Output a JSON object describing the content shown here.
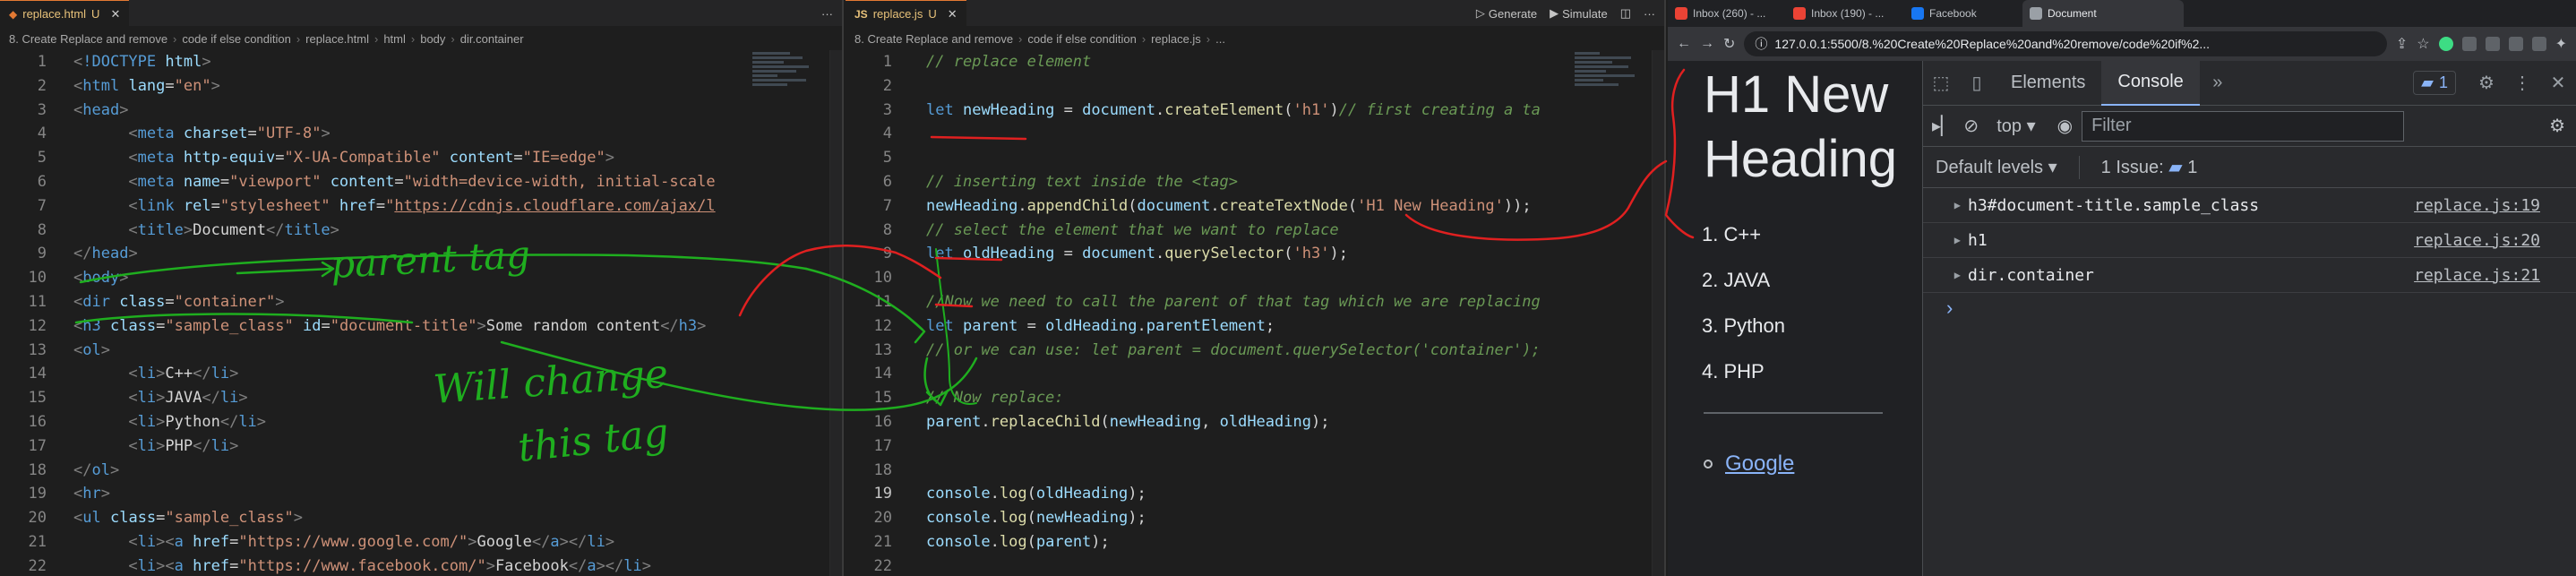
{
  "html_editor": {
    "tab": {
      "filename": "replace.html",
      "status": "U"
    },
    "breadcrumb": [
      "8. Create Replace and remove",
      "code if else condition",
      "replace.html",
      "html",
      "body",
      "dir.container"
    ],
    "lines": [
      {
        "n": "1",
        "html": "<span class='br'>&lt;</span><span class='tag'>!DOCTYPE</span> <span class='attr'>html</span><span class='br'>&gt;</span>"
      },
      {
        "n": "2",
        "html": "<span class='br'>&lt;</span><span class='tag'>html</span> <span class='attr'>lang</span><span class='punc'>=</span><span class='str'>\"en\"</span><span class='br'>&gt;</span>"
      },
      {
        "n": "3",
        "html": "<span class='br'>&lt;</span><span class='tag'>head</span><span class='br'>&gt;</span>"
      },
      {
        "n": "4",
        "html": "      <span class='br'>&lt;</span><span class='tag'>meta</span> <span class='attr'>charset</span><span class='punc'>=</span><span class='str'>\"UTF-8\"</span><span class='br'>&gt;</span>"
      },
      {
        "n": "5",
        "html": "      <span class='br'>&lt;</span><span class='tag'>meta</span> <span class='attr'>http-equiv</span><span class='punc'>=</span><span class='str'>\"X-UA-Compatible\"</span> <span class='attr'>content</span><span class='punc'>=</span><span class='str'>\"IE=edge\"</span><span class='br'>&gt;</span>"
      },
      {
        "n": "6",
        "html": "      <span class='br'>&lt;</span><span class='tag'>meta</span> <span class='attr'>name</span><span class='punc'>=</span><span class='str'>\"viewport\"</span> <span class='attr'>content</span><span class='punc'>=</span><span class='str'>\"width=device-width, initial-scale</span>"
      },
      {
        "n": "7",
        "html": "      <span class='br'>&lt;</span><span class='tag'>link</span> <span class='attr'>rel</span><span class='punc'>=</span><span class='str'>\"stylesheet\"</span> <span class='attr'>href</span><span class='punc'>=</span><span class='str'>\"</span><span class='link'>https://cdnjs.cloudflare.com/ajax/l</span>"
      },
      {
        "n": "8",
        "html": "      <span class='br'>&lt;</span><span class='tag'>title</span><span class='br'>&gt;</span><span class='txt'>Document</span><span class='br'>&lt;/</span><span class='tag'>title</span><span class='br'>&gt;</span>"
      },
      {
        "n": "9",
        "html": "<span class='br'>&lt;/</span><span class='tag'>head</span><span class='br'>&gt;</span>"
      },
      {
        "n": "10",
        "html": "<span class='br'>&lt;</span><span class='tag'>body</span><span class='br'>&gt;</span>"
      },
      {
        "n": "11",
        "html": "<span class='br'>&lt;</span><span class='tag'>dir</span> <span class='attr'>class</span><span class='punc'>=</span><span class='str'>\"container\"</span><span class='br'>&gt;</span>"
      },
      {
        "n": "12",
        "html": "<span class='br'>&lt;</span><span class='tag'>h3</span> <span class='attr'>class</span><span class='punc'>=</span><span class='str'>\"sample_class\"</span> <span class='attr'>id</span><span class='punc'>=</span><span class='str'>\"document-title\"</span><span class='br'>&gt;</span><span class='txt'>Some random content</span><span class='br'>&lt;/</span><span class='tag'>h3</span><span class='br'>&gt;</span>"
      },
      {
        "n": "13",
        "html": "<span class='br'>&lt;</span><span class='tag'>ol</span><span class='br'>&gt;</span>"
      },
      {
        "n": "14",
        "html": "      <span class='br'>&lt;</span><span class='tag'>li</span><span class='br'>&gt;</span><span class='txt'>C++</span><span class='br'>&lt;/</span><span class='tag'>li</span><span class='br'>&gt;</span>"
      },
      {
        "n": "15",
        "html": "      <span class='br'>&lt;</span><span class='tag'>li</span><span class='br'>&gt;</span><span class='txt'>JAVA</span><span class='br'>&lt;/</span><span class='tag'>li</span><span class='br'>&gt;</span>"
      },
      {
        "n": "16",
        "html": "      <span class='br'>&lt;</span><span class='tag'>li</span><span class='br'>&gt;</span><span class='txt'>Python</span><span class='br'>&lt;/</span><span class='tag'>li</span><span class='br'>&gt;</span>"
      },
      {
        "n": "17",
        "html": "      <span class='br'>&lt;</span><span class='tag'>li</span><span class='br'>&gt;</span><span class='txt'>PHP</span><span class='br'>&lt;/</span><span class='tag'>li</span><span class='br'>&gt;</span>"
      },
      {
        "n": "18",
        "html": "<span class='br'>&lt;/</span><span class='tag'>ol</span><span class='br'>&gt;</span>"
      },
      {
        "n": "19",
        "html": "<span class='br'>&lt;</span><span class='tag'>hr</span><span class='br'>&gt;</span>"
      },
      {
        "n": "20",
        "html": "<span class='br'>&lt;</span><span class='tag'>ul</span> <span class='attr'>class</span><span class='punc'>=</span><span class='str'>\"sample_class\"</span><span class='br'>&gt;</span>"
      },
      {
        "n": "21",
        "html": "      <span class='br'>&lt;</span><span class='tag'>li</span><span class='br'>&gt;&lt;</span><span class='tag'>a</span> <span class='attr'>href</span><span class='punc'>=</span><span class='str'>\"https://www.google.com/\"</span><span class='br'>&gt;</span><span class='txt'>Google</span><span class='br'>&lt;/</span><span class='tag'>a</span><span class='br'>&gt;&lt;/</span><span class='tag'>li</span><span class='br'>&gt;</span>"
      },
      {
        "n": "22",
        "html": "      <span class='br'>&lt;</span><span class='tag'>li</span><span class='br'>&gt;&lt;</span><span class='tag'>a</span> <span class='attr'>href</span><span class='punc'>=</span><span class='str'>\"https://www.facebook.com/\"</span><span class='br'>&gt;</span><span class='txt'>Facebook</span><span class='br'>&lt;/</span><span class='tag'>a</span><span class='br'>&gt;&lt;/</span><span class='tag'>li</span><span class='br'>&gt;</span>"
      }
    ]
  },
  "js_editor": {
    "tab": {
      "filename": "replace.js",
      "status": "U"
    },
    "breadcrumb": [
      "8. Create Replace and remove",
      "code if else condition",
      "replace.js",
      "..."
    ],
    "toolbar": {
      "generate": "Generate",
      "simulate": "Simulate"
    },
    "active_line": "19",
    "lines": [
      {
        "n": "1",
        "html": "<span class='cm'>// replace element</span>"
      },
      {
        "n": "2",
        "html": ""
      },
      {
        "n": "3",
        "html": "<span class='kw'>let</span> <span class='var'>newHeading</span> <span class='punc'>=</span> <span class='var'>document</span><span class='punc'>.</span><span class='fn'>createElement</span><span class='punc'>(</span><span class='str'>'h1'</span><span class='punc'>)</span><span class='cm'>// first creating a ta</span>"
      },
      {
        "n": "4",
        "html": ""
      },
      {
        "n": "5",
        "html": ""
      },
      {
        "n": "6",
        "html": "<span class='cm'>// inserting text inside the &lt;tag&gt;</span>"
      },
      {
        "n": "7",
        "html": "<span class='var'>newHeading</span><span class='punc'>.</span><span class='fn'>appendChild</span><span class='punc'>(</span><span class='var'>document</span><span class='punc'>.</span><span class='fn'>createTextNode</span><span class='punc'>(</span><span class='str'>'H1 New Heading'</span><span class='punc'>));</span>"
      },
      {
        "n": "8",
        "html": "<span class='cm'>// select the element that we want to replace</span>"
      },
      {
        "n": "9",
        "html": "<span class='kw'>let</span> <span class='var'>oldHeading</span> <span class='punc'>=</span> <span class='var'>document</span><span class='punc'>.</span><span class='fn'>querySelector</span><span class='punc'>(</span><span class='str'>'h3'</span><span class='punc'>);</span>"
      },
      {
        "n": "10",
        "html": ""
      },
      {
        "n": "11",
        "html": "<span class='cm'>//Now we need to call the parent of that tag which we are replacing</span>"
      },
      {
        "n": "12",
        "html": "<span class='kw'>let</span> <span class='var'>parent</span> <span class='punc'>=</span> <span class='var'>oldHeading</span><span class='punc'>.</span><span class='var'>parentElement</span><span class='punc'>;</span>"
      },
      {
        "n": "13",
        "html": "<span class='cm'>// or we can use: let parent = document.querySelector('container');</span>"
      },
      {
        "n": "14",
        "html": ""
      },
      {
        "n": "15",
        "html": "<span class='cm'>// Now replace:</span>"
      },
      {
        "n": "16",
        "html": "<span class='var'>parent</span><span class='punc'>.</span><span class='fn'>replaceChild</span><span class='punc'>(</span><span class='var'>newHeading</span><span class='punc'>,</span> <span class='var'>oldHeading</span><span class='punc'>);</span>"
      },
      {
        "n": "17",
        "html": ""
      },
      {
        "n": "18",
        "html": ""
      },
      {
        "n": "19",
        "html": "<span class='var'>console</span><span class='punc'>.</span><span class='fn'>log</span><span class='punc'>(</span><span class='var'>oldHeading</span><span class='punc'>);</span>"
      },
      {
        "n": "20",
        "html": "<span class='var'>console</span><span class='punc'>.</span><span class='fn'>log</span><span class='punc'>(</span><span class='var'>newHeading</span><span class='punc'>);</span>"
      },
      {
        "n": "21",
        "html": "<span class='var'>console</span><span class='punc'>.</span><span class='fn'>log</span><span class='punc'>(</span><span class='var'>parent</span><span class='punc'>);</span>"
      },
      {
        "n": "22",
        "html": ""
      }
    ]
  },
  "annotations": {
    "note1": "parent tag",
    "note2a": "Will change",
    "note2b": "this tag",
    "ink_color": "#1fae1f",
    "red_ink": "#e02020"
  },
  "browser": {
    "tabs": [
      "Inbox (260) - ...",
      "Inbox (190) - ...",
      "Facebook",
      "Document"
    ],
    "url": "127.0.0.1:5500/8.%20Create%20Replace%20and%20remove/code%20if%2...",
    "page": {
      "heading": "H1 New Heading",
      "list": [
        "1. C++",
        "2. JAVA",
        "3. Python",
        "4. PHP"
      ],
      "link": "Google"
    },
    "devtools": {
      "tabs": [
        "Elements",
        "Console"
      ],
      "active_tab": "Console",
      "issues_count": "1",
      "context": "top",
      "filter_placeholder": "Filter",
      "levels": "Default levels",
      "issue_label": "1 Issue:",
      "issue_num": "1",
      "logs": [
        {
          "text": "h3#document-title.sample_class",
          "source": "replace.js:19"
        },
        {
          "text": "h1",
          "source": "replace.js:20"
        },
        {
          "text": "dir.container",
          "source": "replace.js:21"
        }
      ],
      "prompt": "›"
    }
  }
}
